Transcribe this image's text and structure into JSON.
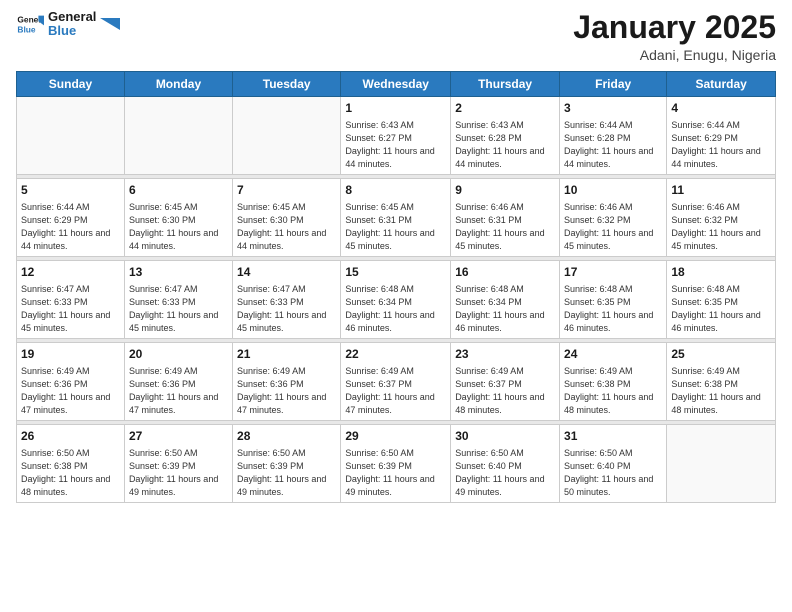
{
  "header": {
    "logo_general": "General",
    "logo_blue": "Blue",
    "month_title": "January 2025",
    "subtitle": "Adani, Enugu, Nigeria"
  },
  "weekdays": [
    "Sunday",
    "Monday",
    "Tuesday",
    "Wednesday",
    "Thursday",
    "Friday",
    "Saturday"
  ],
  "weeks": [
    [
      {
        "day": "",
        "sunrise": "",
        "sunset": "",
        "daylight": ""
      },
      {
        "day": "",
        "sunrise": "",
        "sunset": "",
        "daylight": ""
      },
      {
        "day": "",
        "sunrise": "",
        "sunset": "",
        "daylight": ""
      },
      {
        "day": "1",
        "sunrise": "Sunrise: 6:43 AM",
        "sunset": "Sunset: 6:27 PM",
        "daylight": "Daylight: 11 hours and 44 minutes."
      },
      {
        "day": "2",
        "sunrise": "Sunrise: 6:43 AM",
        "sunset": "Sunset: 6:28 PM",
        "daylight": "Daylight: 11 hours and 44 minutes."
      },
      {
        "day": "3",
        "sunrise": "Sunrise: 6:44 AM",
        "sunset": "Sunset: 6:28 PM",
        "daylight": "Daylight: 11 hours and 44 minutes."
      },
      {
        "day": "4",
        "sunrise": "Sunrise: 6:44 AM",
        "sunset": "Sunset: 6:29 PM",
        "daylight": "Daylight: 11 hours and 44 minutes."
      }
    ],
    [
      {
        "day": "5",
        "sunrise": "Sunrise: 6:44 AM",
        "sunset": "Sunset: 6:29 PM",
        "daylight": "Daylight: 11 hours and 44 minutes."
      },
      {
        "day": "6",
        "sunrise": "Sunrise: 6:45 AM",
        "sunset": "Sunset: 6:30 PM",
        "daylight": "Daylight: 11 hours and 44 minutes."
      },
      {
        "day": "7",
        "sunrise": "Sunrise: 6:45 AM",
        "sunset": "Sunset: 6:30 PM",
        "daylight": "Daylight: 11 hours and 44 minutes."
      },
      {
        "day": "8",
        "sunrise": "Sunrise: 6:45 AM",
        "sunset": "Sunset: 6:31 PM",
        "daylight": "Daylight: 11 hours and 45 minutes."
      },
      {
        "day": "9",
        "sunrise": "Sunrise: 6:46 AM",
        "sunset": "Sunset: 6:31 PM",
        "daylight": "Daylight: 11 hours and 45 minutes."
      },
      {
        "day": "10",
        "sunrise": "Sunrise: 6:46 AM",
        "sunset": "Sunset: 6:32 PM",
        "daylight": "Daylight: 11 hours and 45 minutes."
      },
      {
        "day": "11",
        "sunrise": "Sunrise: 6:46 AM",
        "sunset": "Sunset: 6:32 PM",
        "daylight": "Daylight: 11 hours and 45 minutes."
      }
    ],
    [
      {
        "day": "12",
        "sunrise": "Sunrise: 6:47 AM",
        "sunset": "Sunset: 6:33 PM",
        "daylight": "Daylight: 11 hours and 45 minutes."
      },
      {
        "day": "13",
        "sunrise": "Sunrise: 6:47 AM",
        "sunset": "Sunset: 6:33 PM",
        "daylight": "Daylight: 11 hours and 45 minutes."
      },
      {
        "day": "14",
        "sunrise": "Sunrise: 6:47 AM",
        "sunset": "Sunset: 6:33 PM",
        "daylight": "Daylight: 11 hours and 45 minutes."
      },
      {
        "day": "15",
        "sunrise": "Sunrise: 6:48 AM",
        "sunset": "Sunset: 6:34 PM",
        "daylight": "Daylight: 11 hours and 46 minutes."
      },
      {
        "day": "16",
        "sunrise": "Sunrise: 6:48 AM",
        "sunset": "Sunset: 6:34 PM",
        "daylight": "Daylight: 11 hours and 46 minutes."
      },
      {
        "day": "17",
        "sunrise": "Sunrise: 6:48 AM",
        "sunset": "Sunset: 6:35 PM",
        "daylight": "Daylight: 11 hours and 46 minutes."
      },
      {
        "day": "18",
        "sunrise": "Sunrise: 6:48 AM",
        "sunset": "Sunset: 6:35 PM",
        "daylight": "Daylight: 11 hours and 46 minutes."
      }
    ],
    [
      {
        "day": "19",
        "sunrise": "Sunrise: 6:49 AM",
        "sunset": "Sunset: 6:36 PM",
        "daylight": "Daylight: 11 hours and 47 minutes."
      },
      {
        "day": "20",
        "sunrise": "Sunrise: 6:49 AM",
        "sunset": "Sunset: 6:36 PM",
        "daylight": "Daylight: 11 hours and 47 minutes."
      },
      {
        "day": "21",
        "sunrise": "Sunrise: 6:49 AM",
        "sunset": "Sunset: 6:36 PM",
        "daylight": "Daylight: 11 hours and 47 minutes."
      },
      {
        "day": "22",
        "sunrise": "Sunrise: 6:49 AM",
        "sunset": "Sunset: 6:37 PM",
        "daylight": "Daylight: 11 hours and 47 minutes."
      },
      {
        "day": "23",
        "sunrise": "Sunrise: 6:49 AM",
        "sunset": "Sunset: 6:37 PM",
        "daylight": "Daylight: 11 hours and 48 minutes."
      },
      {
        "day": "24",
        "sunrise": "Sunrise: 6:49 AM",
        "sunset": "Sunset: 6:38 PM",
        "daylight": "Daylight: 11 hours and 48 minutes."
      },
      {
        "day": "25",
        "sunrise": "Sunrise: 6:49 AM",
        "sunset": "Sunset: 6:38 PM",
        "daylight": "Daylight: 11 hours and 48 minutes."
      }
    ],
    [
      {
        "day": "26",
        "sunrise": "Sunrise: 6:50 AM",
        "sunset": "Sunset: 6:38 PM",
        "daylight": "Daylight: 11 hours and 48 minutes."
      },
      {
        "day": "27",
        "sunrise": "Sunrise: 6:50 AM",
        "sunset": "Sunset: 6:39 PM",
        "daylight": "Daylight: 11 hours and 49 minutes."
      },
      {
        "day": "28",
        "sunrise": "Sunrise: 6:50 AM",
        "sunset": "Sunset: 6:39 PM",
        "daylight": "Daylight: 11 hours and 49 minutes."
      },
      {
        "day": "29",
        "sunrise": "Sunrise: 6:50 AM",
        "sunset": "Sunset: 6:39 PM",
        "daylight": "Daylight: 11 hours and 49 minutes."
      },
      {
        "day": "30",
        "sunrise": "Sunrise: 6:50 AM",
        "sunset": "Sunset: 6:40 PM",
        "daylight": "Daylight: 11 hours and 49 minutes."
      },
      {
        "day": "31",
        "sunrise": "Sunrise: 6:50 AM",
        "sunset": "Sunset: 6:40 PM",
        "daylight": "Daylight: 11 hours and 50 minutes."
      },
      {
        "day": "",
        "sunrise": "",
        "sunset": "",
        "daylight": ""
      }
    ]
  ]
}
